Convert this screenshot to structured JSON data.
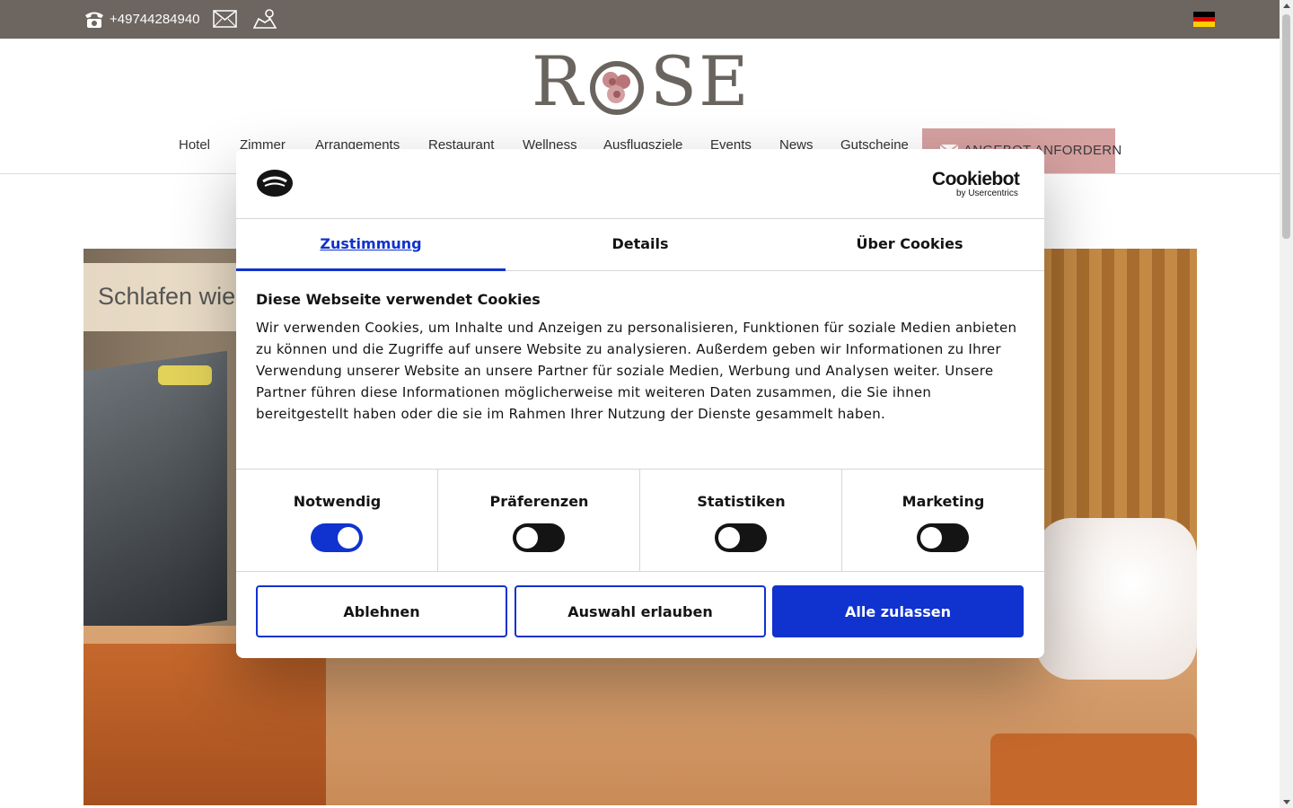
{
  "topbar": {
    "phone": "+49744284940",
    "colors": {
      "background": "#6c6560",
      "text": "#ffffff"
    },
    "icons": [
      "phone-icon",
      "mail-icon",
      "map-icon",
      "flag-de-icon"
    ]
  },
  "header": {
    "logo_text_r": "R",
    "logo_text_se": "SE",
    "nav": [
      "Hotel",
      "Zimmer",
      "Arrangements",
      "Restaurant",
      "Wellness",
      "Ausflugsziele",
      "Events",
      "News",
      "Gutscheine"
    ],
    "offer_button": "ANGEBOT ANFORDERN",
    "offer_color": "#d6a1a1"
  },
  "hero": {
    "caption": "Schlafen wie"
  },
  "cookie": {
    "brand_name": "Cookiebot",
    "brand_sub": "by Usercentrics",
    "tabs": [
      "Zustimmung",
      "Details",
      "Über Cookies"
    ],
    "active_tab": "Zustimmung",
    "title": "Diese Webseite verwendet Cookies",
    "text": "Wir verwenden Cookies, um Inhalte und Anzeigen zu personalisieren, Funktionen für soziale Medien anbieten zu können und die Zugriffe auf unsere Website zu analysieren. Außerdem geben wir Informationen zu Ihrer Verwendung unserer Website an unsere Partner für soziale Medien, Werbung und Analysen weiter. Unsere Partner führen diese Informationen möglicherweise mit weiteren Daten zusammen, die Sie ihnen bereitgestellt haben oder die sie im Rahmen Ihrer Nutzung der Dienste gesammelt haben.",
    "options": [
      {
        "label": "Notwendig",
        "on": true
      },
      {
        "label": "Präferenzen",
        "on": false
      },
      {
        "label": "Statistiken",
        "on": false
      },
      {
        "label": "Marketing",
        "on": false
      }
    ],
    "buttons": {
      "reject": "Ablehnen",
      "allow_selection": "Auswahl erlauben",
      "allow_all": "Alle zulassen"
    },
    "colors": {
      "accent": "#1032cf",
      "text": "#141414"
    }
  }
}
